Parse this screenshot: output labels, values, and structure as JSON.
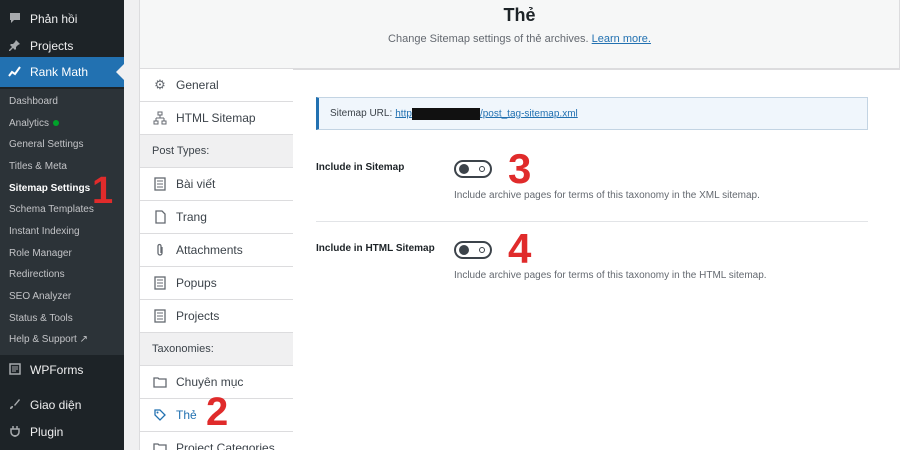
{
  "wp_menu": {
    "phanhoi": "Phản hồi",
    "projects": "Projects",
    "rankmath": "Rank Math",
    "wpforms": "WPForms",
    "giaodien": "Giao diện",
    "plugin": "Plugin"
  },
  "rank_math_submenu": {
    "dashboard": "Dashboard",
    "analytics": "Analytics",
    "general": "General Settings",
    "titles": "Titles & Meta",
    "sitemap": "Sitemap Settings",
    "schema": "Schema Templates",
    "instant": "Instant Indexing",
    "role": "Role Manager",
    "redirections": "Redirections",
    "seo": "SEO Analyzer",
    "status": "Status & Tools",
    "help": "Help & Support"
  },
  "header": {
    "title": "Thẻ",
    "description": "Change Sitemap settings of thẻ archives.",
    "learn_more": "Learn more."
  },
  "tabs": {
    "general": "General",
    "html_sitemap": "HTML Sitemap",
    "post_types_group": "Post Types:",
    "bai_viet": "Bài viết",
    "trang": "Trang",
    "attachments": "Attachments",
    "popups": "Popups",
    "projects": "Projects",
    "taxonomies_group": "Taxonomies:",
    "chuyen_muc": "Chuyên mục",
    "the": "Thẻ",
    "project_categories": "Project Categories"
  },
  "content": {
    "sitemap_url_label": "Sitemap URL:",
    "sitemap_url_prefix": "http",
    "sitemap_url_suffix": "/post_tag-sitemap.xml",
    "include_sitemap_label": "Include in Sitemap",
    "include_sitemap_desc": "Include archive pages for terms of this taxonomy in the XML sitemap.",
    "include_html_label": "Include in HTML Sitemap",
    "include_html_desc": "Include archive pages for terms of this taxonomy in the HTML sitemap."
  },
  "toggles": {
    "include_sitemap_on": false,
    "include_html_on": false
  },
  "annotations": {
    "a1": "1",
    "a2": "2",
    "a3": "3",
    "a4": "4"
  },
  "colors": {
    "wp_dark": "#1d2327",
    "wp_blue": "#2271b1",
    "annotation_red": "#e02b2b"
  },
  "icons": {
    "phanhoi": "comment-icon",
    "projects": "pin-icon",
    "rankmath": "rank-math-icon",
    "wpforms": "wpforms-icon",
    "giaodien": "paintbrush-icon",
    "plugin": "plugin-icon",
    "general": "gear-icon",
    "html_sitemap": "sitemap-icon",
    "post": "document-icon",
    "page": "page-icon",
    "attachment": "paperclip-icon",
    "folder": "folder-icon",
    "tag": "tag-icon"
  }
}
